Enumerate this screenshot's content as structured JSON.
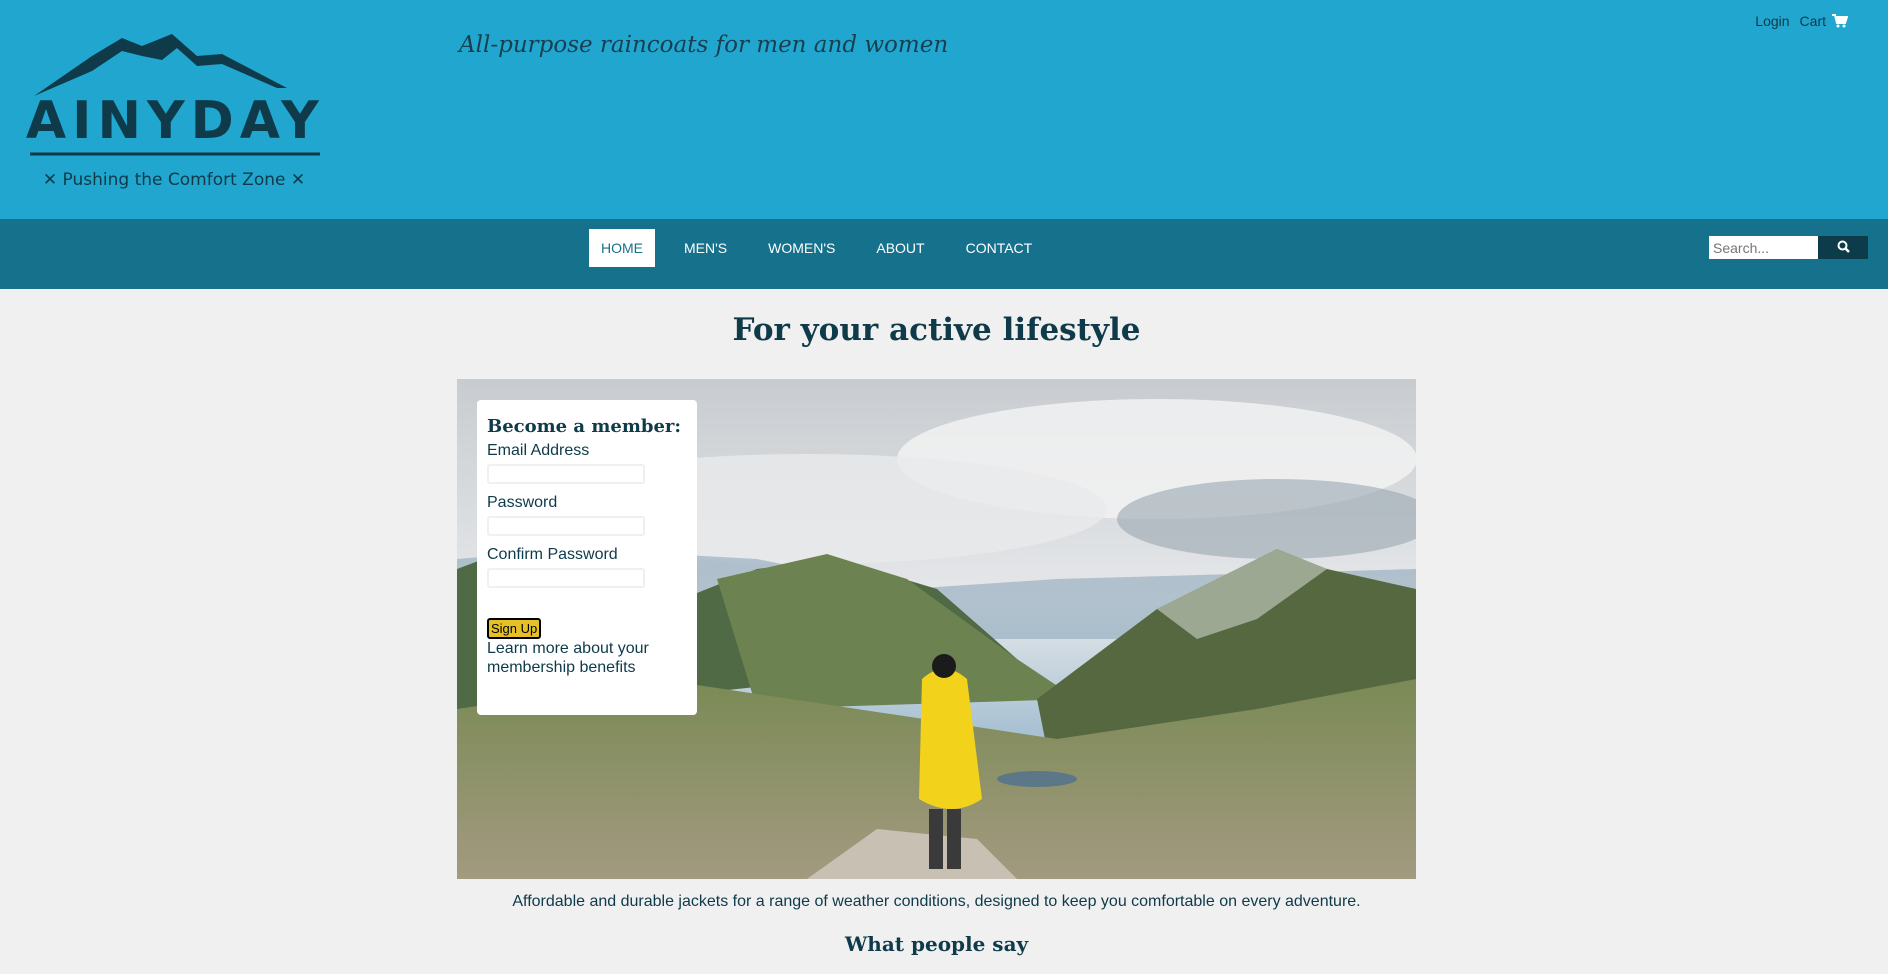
{
  "header": {
    "logo_word": "RAINYDAYS",
    "logo_slogan": "✕ Pushing the Comfort Zone ✕",
    "tagline": "All-purpose raincoats for men and women",
    "login_label": "Login",
    "cart_label": "Cart",
    "cart_icon": "shopping-cart-icon",
    "brand_color": "#21a7cf"
  },
  "nav": {
    "items": [
      {
        "label": "HOME",
        "active": true
      },
      {
        "label": "MEN'S"
      },
      {
        "label": "WOMEN'S"
      },
      {
        "label": "ABOUT"
      },
      {
        "label": "CONTACT"
      }
    ],
    "search_placeholder": "Search...",
    "search_icon": "search-icon",
    "nav_color": "#16728c"
  },
  "main": {
    "title": "For your active lifestyle",
    "hero_alt": "Hiker in yellow raincoat overlooking mountain valley",
    "description": "Affordable and durable jackets for a range of weather conditions, designed to keep you comfortable on every adventure.",
    "testimonials_title": "What people say"
  },
  "signup": {
    "title": "Become a member:",
    "email_label": "Email Address",
    "email_value": "",
    "password_label": "Password",
    "password_value": "",
    "confirm_label": "Confirm Password",
    "confirm_value": "",
    "button_label": "Sign Up",
    "button_color": "#e5c127",
    "learn_more": "Learn more about your membership benefits"
  }
}
